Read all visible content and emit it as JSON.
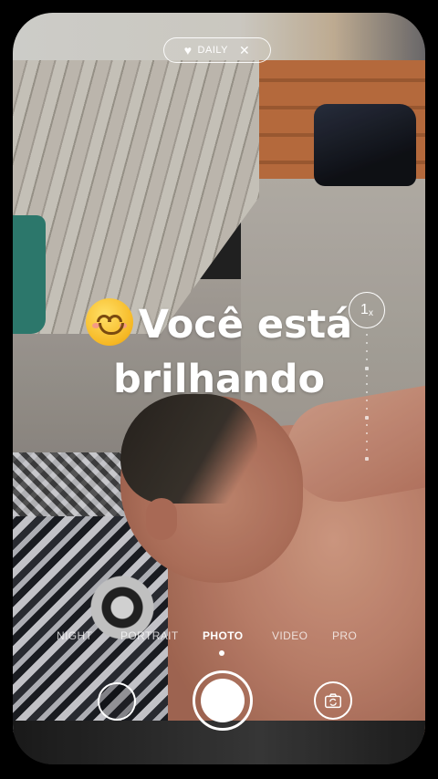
{
  "badge": {
    "label": "DAILY",
    "heart": "♥",
    "close": "✕"
  },
  "headline": {
    "line1": "Você está",
    "line2": "brilhando"
  },
  "zoom": {
    "value": "1",
    "unit": "x"
  },
  "modes": [
    {
      "label": "NIGHT",
      "active": false
    },
    {
      "label": "PORTRAIT",
      "active": false
    },
    {
      "label": "PHOTO",
      "active": true
    },
    {
      "label": "VIDEO",
      "active": false
    },
    {
      "label": "PRO",
      "active": false
    }
  ],
  "icons": {
    "emoji": "smiling-face-icon",
    "flip": "camera-flip-icon",
    "gallery": "gallery-thumbnail-icon",
    "shutter": "shutter-button-icon"
  },
  "colors": {
    "text": "#ffffff",
    "background": "#000000"
  }
}
